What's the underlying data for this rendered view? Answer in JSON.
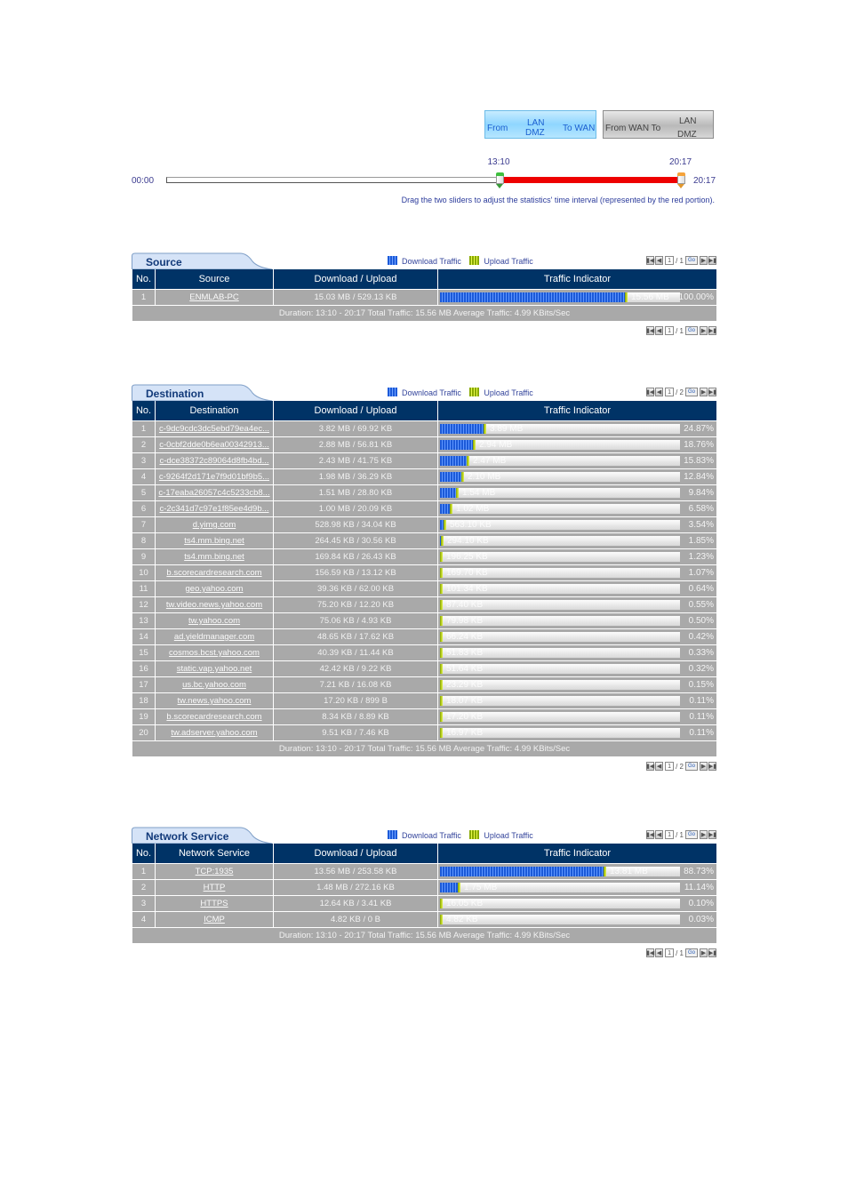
{
  "direction": {
    "lan_dmz_to_wan": {
      "from": "From",
      "lan": "LAN",
      "dmz": "DMZ",
      "to": "To WAN",
      "selected": true
    },
    "wan_to_lan_dmz": {
      "from": "From WAN To",
      "lan": "LAN",
      "dmz": "DMZ",
      "selected": false
    }
  },
  "time_slider": {
    "start_label": "00:00",
    "end_label": "20:17",
    "left_handle_value": "13:10",
    "right_handle_value": "20:17",
    "left_handle_fraction": 0.6474,
    "right_handle_fraction": 1.0,
    "hint": "Drag the two sliders to adjust the statistics' time interval (represented by the red portion)."
  },
  "legend": {
    "download": "Download Traffic",
    "upload": "Upload Traffic"
  },
  "pager_go": "Go",
  "summary": "Duration: 13:10 - 20:17   Total Traffic: 15.56 MB   Average Traffic: 4.99 KBits/Sec",
  "columns": {
    "no": "No.",
    "download_upload": "Download / Upload",
    "traffic_indicator": "Traffic Indicator"
  },
  "source": {
    "title": "Source",
    "column": "Source",
    "page": "1",
    "total_pages": "1",
    "rows": [
      {
        "no": "1",
        "name": "ENMLAB-PC",
        "dlul": "15.03 MB / 529.13 KB",
        "dl_frac": 0.966,
        "ul_frac": 0.034,
        "bar_frac": 0.78,
        "total": "15.56 MB",
        "pct": "100.00%"
      }
    ]
  },
  "destination": {
    "title": "Destination",
    "column": "Destination",
    "page": "1",
    "total_pages": "2",
    "rows": [
      {
        "no": "1",
        "name": "c-9dc9cdc3dc5ebd79ea4ec...",
        "dlul": "3.82 MB / 69.92 KB",
        "pct_value": 24.87,
        "total": "3.89 MB",
        "pct": "24.87%"
      },
      {
        "no": "2",
        "name": "c-0cbf2dde0b6ea00342913...",
        "dlul": "2.88 MB / 56.81 KB",
        "pct_value": 18.76,
        "total": "2.94 MB",
        "pct": "18.76%"
      },
      {
        "no": "3",
        "name": "c-dce38372c89064d8fb4bd...",
        "dlul": "2.43 MB / 41.75 KB",
        "pct_value": 15.83,
        "total": "2.47 MB",
        "pct": "15.83%"
      },
      {
        "no": "4",
        "name": "c-9264f2d171e7f9d01bf9b5...",
        "dlul": "1.98 MB / 36.29 KB",
        "pct_value": 12.84,
        "total": "2.10 MB",
        "pct": "12.84%"
      },
      {
        "no": "5",
        "name": "c-17eaba26057c4c5233cb8...",
        "dlul": "1.51 MB / 28.80 KB",
        "pct_value": 9.84,
        "total": "1.54 MB",
        "pct": "9.84%"
      },
      {
        "no": "6",
        "name": "c-2c341d7c97e1f85ee4d9b...",
        "dlul": "1.00 MB / 20.09 KB",
        "pct_value": 6.58,
        "total": "1.02 MB",
        "pct": "6.58%"
      },
      {
        "no": "7",
        "name": "d.yimg.com",
        "dlul": "528.98 KB / 34.04 KB",
        "pct_value": 3.54,
        "total": "563.10 KB",
        "pct": "3.54%"
      },
      {
        "no": "8",
        "name": "ts4.mm.bing.net",
        "dlul": "264.45 KB / 30.56 KB",
        "pct_value": 1.85,
        "total": "294.10 KB",
        "pct": "1.85%"
      },
      {
        "no": "9",
        "name": "ts4.mm.bing.net",
        "dlul": "169.84 KB / 26.43 KB",
        "pct_value": 1.23,
        "total": "196.25 KB",
        "pct": "1.23%"
      },
      {
        "no": "10",
        "name": "b.scorecardresearch.com",
        "dlul": "156.59 KB / 13.12 KB",
        "pct_value": 1.07,
        "total": "169.70 KB",
        "pct": "1.07%"
      },
      {
        "no": "11",
        "name": "geo.yahoo.com",
        "dlul": "39.36 KB / 62.00 KB",
        "pct_value": 0.64,
        "total": "101.34 KB",
        "pct": "0.64%"
      },
      {
        "no": "12",
        "name": "tw.video.news.yahoo.com",
        "dlul": "75.20 KB / 12.20 KB",
        "pct_value": 0.55,
        "total": "87.40 KB",
        "pct": "0.55%"
      },
      {
        "no": "13",
        "name": "tw.yahoo.com",
        "dlul": "75.06 KB / 4.93 KB",
        "pct_value": 0.5,
        "total": "79.98 KB",
        "pct": "0.50%"
      },
      {
        "no": "14",
        "name": "ad.yieldmanager.com",
        "dlul": "48.65 KB / 17.62 KB",
        "pct_value": 0.42,
        "total": "66.24 KB",
        "pct": "0.42%"
      },
      {
        "no": "15",
        "name": "cosmos.bcst.yahoo.com",
        "dlul": "40.39 KB / 11.44 KB",
        "pct_value": 0.33,
        "total": "51.83 KB",
        "pct": "0.33%"
      },
      {
        "no": "16",
        "name": "static.vap.yahoo.net",
        "dlul": "42.42 KB / 9.22 KB",
        "pct_value": 0.32,
        "total": "51.64 KB",
        "pct": "0.32%"
      },
      {
        "no": "17",
        "name": "us.bc.yahoo.com",
        "dlul": "7.21 KB / 16.08 KB",
        "pct_value": 0.15,
        "total": "23.29 KB",
        "pct": "0.15%"
      },
      {
        "no": "18",
        "name": "tw.news.yahoo.com",
        "dlul": "17.20 KB / 899 B",
        "pct_value": 0.11,
        "total": "18.07 KB",
        "pct": "0.11%"
      },
      {
        "no": "19",
        "name": "b.scorecardresearch.com",
        "dlul": "8.34 KB / 8.89 KB",
        "pct_value": 0.11,
        "total": "17.20 KB",
        "pct": "0.11%"
      },
      {
        "no": "20",
        "name": "tw.adserver.yahoo.com",
        "dlul": "9.51 KB / 7.46 KB",
        "pct_value": 0.11,
        "total": "16.97 KB",
        "pct": "0.11%"
      }
    ]
  },
  "network_service": {
    "title": "Network Service",
    "column": "Network Service",
    "page": "1",
    "total_pages": "1",
    "rows": [
      {
        "no": "1",
        "name": "TCP:1935",
        "dlul": "13.56 MB / 253.58 KB",
        "pct_value": 88.73,
        "total": "13.81 MB",
        "pct": "88.73%"
      },
      {
        "no": "2",
        "name": "HTTP",
        "dlul": "1.48 MB / 272.16 KB",
        "pct_value": 11.14,
        "total": "1.75 MB",
        "pct": "11.14%"
      },
      {
        "no": "3",
        "name": "HTTPS",
        "dlul": "12.64 KB / 3.41 KB",
        "pct_value": 0.1,
        "total": "16.05 KB",
        "pct": "0.10%"
      },
      {
        "no": "4",
        "name": "ICMP",
        "dlul": "4.82 KB / 0 B",
        "pct_value": 0.03,
        "total": "4.82 KB",
        "pct": "0.03%"
      }
    ]
  }
}
